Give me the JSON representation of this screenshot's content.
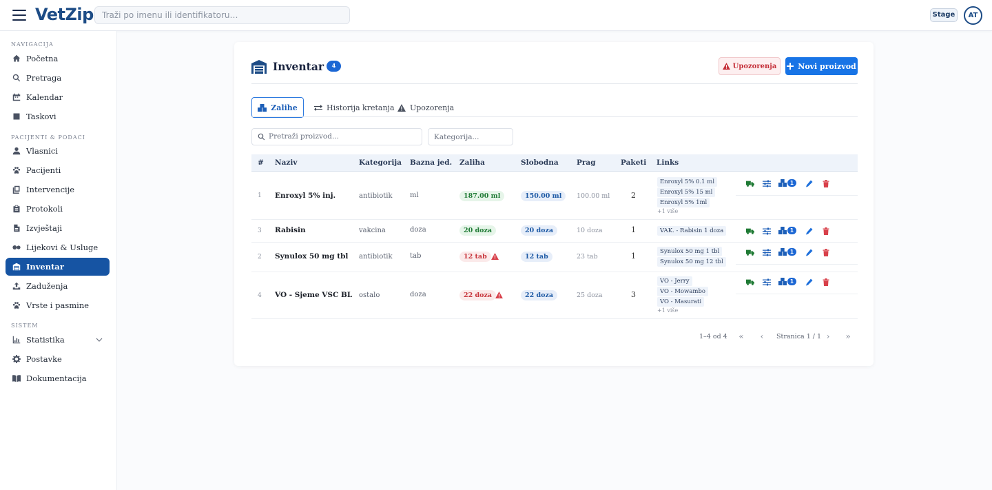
{
  "header": {
    "logo": "VetZip",
    "search_placeholder": "Traži po imenu ili identifikatoru…",
    "env_badge": "Stage",
    "avatar": "AT"
  },
  "sidebar": {
    "sections": [
      {
        "title": "NAVIGACIJA",
        "items": [
          {
            "label": "Početna",
            "icon": "home-icon"
          },
          {
            "label": "Pretraga",
            "icon": "search-icon"
          },
          {
            "label": "Kalendar",
            "icon": "calendar-icon"
          },
          {
            "label": "Taskovi",
            "icon": "checkbox-icon"
          }
        ]
      },
      {
        "title": "PACIJENTI & PODACI",
        "items": [
          {
            "label": "Vlasnici",
            "icon": "user-icon"
          },
          {
            "label": "Pacijenti",
            "icon": "paw-icon"
          },
          {
            "label": "Intervencije",
            "icon": "clipboard-icon"
          },
          {
            "label": "Protokoli",
            "icon": "clipboard-list-icon"
          },
          {
            "label": "Izvještaji",
            "icon": "file-icon"
          },
          {
            "label": "Lijekovi & Usluge",
            "icon": "pills-icon"
          },
          {
            "label": "Inventar",
            "icon": "warehouse-icon",
            "active": true
          },
          {
            "label": "Zaduženja",
            "icon": "upload-icon"
          },
          {
            "label": "Vrste i pasmine",
            "icon": "paw-icon"
          }
        ]
      },
      {
        "title": "SISTEM",
        "items": [
          {
            "label": "Statistika",
            "icon": "chart-icon"
          },
          {
            "label": "Postavke",
            "icon": "gear-icon"
          },
          {
            "label": "Dokumentacija",
            "icon": "book-icon"
          }
        ]
      }
    ]
  },
  "page": {
    "title": "Inventar",
    "count": "4",
    "warnings_button": "Upozorenja",
    "new_button": "Novi proizvod",
    "tabs": [
      "Zalihe",
      "Historija kretanja",
      "Upozorenja"
    ],
    "filter_product_placeholder": "Pretraži proizvod...",
    "filter_category_placeholder": "Kategorija..."
  },
  "table": {
    "columns": [
      "#",
      "Naziv",
      "Kategorija",
      "Bazna jed.",
      "Zaliha",
      "Slobodna",
      "Prag",
      "Paketi",
      "Links"
    ],
    "rows": [
      {
        "num": "1",
        "name": "Enroxyl 5% inj.",
        "category": "antibiotik",
        "unit": "ml",
        "stock": "187.00 ml",
        "stock_status": "ok",
        "free": "150.00 ml",
        "threshold": "100.00 ml",
        "packages": "2",
        "links": [
          "Enroxyl 5% 0.1 ml",
          "Enroxyl 5% 15 ml",
          "Enroxyl 5% 1ml"
        ],
        "more": "+1 više",
        "package_count": "1"
      },
      {
        "num": "3",
        "name": "Rabisin",
        "category": "vakcina",
        "unit": "doza",
        "stock": "20 doza",
        "stock_status": "ok",
        "free": "20 doza",
        "threshold": "10 doza",
        "packages": "1",
        "links": [
          "VAK. - Rabisin 1 doza"
        ],
        "more": "",
        "package_count": "1"
      },
      {
        "num": "2",
        "name": "Synulox 50 mg tbl",
        "category": "antibiotik",
        "unit": "tab",
        "stock": "12 tab",
        "stock_status": "low",
        "free": "12 tab",
        "threshold": "23 tab",
        "packages": "1",
        "links": [
          "Synulox 50 mg 1 tbl",
          "Synulox 50 mg 12 tbl"
        ],
        "more": "",
        "package_count": "1"
      },
      {
        "num": "4",
        "name": "VO - Sjeme VSC BL",
        "category": "ostalo",
        "unit": "doza",
        "stock": "22 doza",
        "stock_status": "low",
        "free": "22 doza",
        "threshold": "25 doza",
        "packages": "3",
        "links": [
          "VO - Jerry",
          "VO - Mowambo",
          "VO - Masurati"
        ],
        "more": "+1 više",
        "package_count": "1"
      }
    ]
  },
  "pagination": {
    "range": "1–4 od 4",
    "page_label": "Stranica 1 / 1"
  },
  "colors": {
    "brand": "#1d4c86",
    "primary": "#1874e6",
    "active_nav": "#1654a3",
    "danger": "#c7343b",
    "success": "#1f7a34"
  }
}
